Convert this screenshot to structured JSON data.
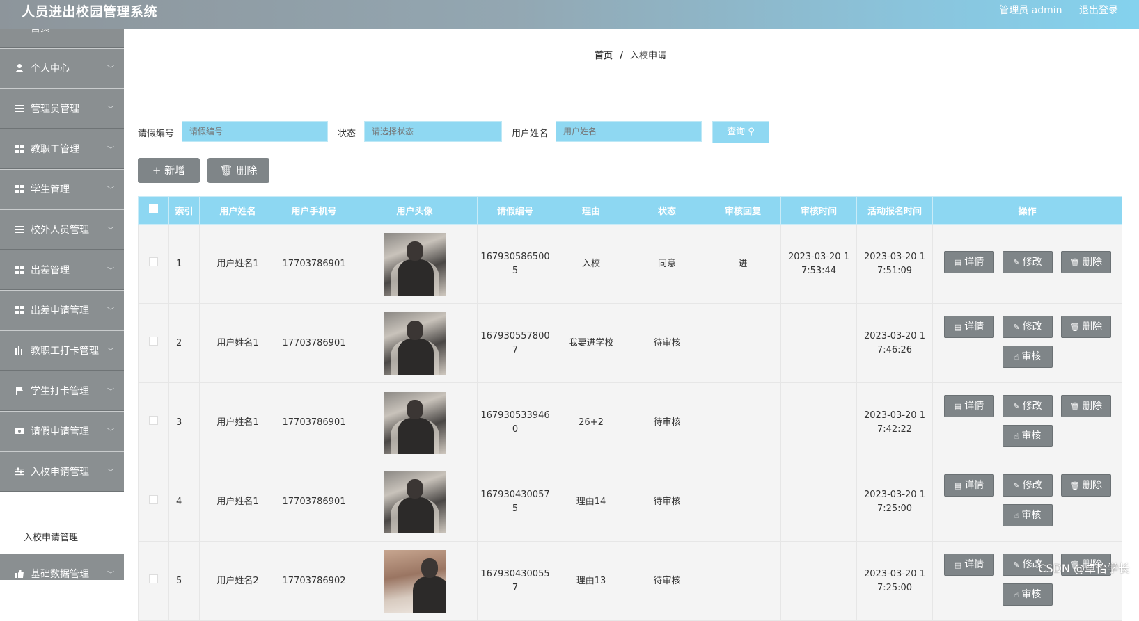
{
  "app": {
    "title": "人员进出校园管理系统",
    "user_label": "管理员 admin",
    "logout_label": "退出登录"
  },
  "sidebar": {
    "items": [
      {
        "label": "首页",
        "icon": "home-icon"
      },
      {
        "label": "个人中心",
        "icon": "user-icon"
      },
      {
        "label": "管理员管理",
        "icon": "list-icon"
      },
      {
        "label": "教职工管理",
        "icon": "grid-icon"
      },
      {
        "label": "学生管理",
        "icon": "grid-icon"
      },
      {
        "label": "校外人员管理",
        "icon": "list-icon"
      },
      {
        "label": "出差管理",
        "icon": "grid-icon"
      },
      {
        "label": "出差申请管理",
        "icon": "grid-icon"
      },
      {
        "label": "教职工打卡管理",
        "icon": "chart-icon"
      },
      {
        "label": "学生打卡管理",
        "icon": "flag-icon"
      },
      {
        "label": "请假申请管理",
        "icon": "ticket-icon"
      },
      {
        "label": "入校申请管理",
        "icon": "sliders-icon"
      },
      {
        "label": "基础数据管理",
        "icon": "thumb-icon"
      }
    ],
    "submenu_active": "入校申请管理"
  },
  "breadcrumb": {
    "home": "首页",
    "sep": "/",
    "current": "入校申请"
  },
  "search": {
    "leave_no_label": "请假编号",
    "leave_no_placeholder": "请假编号",
    "status_label": "状态",
    "status_placeholder": "请选择状态",
    "username_label": "用户姓名",
    "username_placeholder": "用户姓名",
    "query_label": "查询"
  },
  "actions": {
    "add_label": "新增",
    "delete_label": "删除"
  },
  "table": {
    "headers": [
      "索引",
      "用户姓名",
      "用户手机号",
      "用户头像",
      "请假编号",
      "理由",
      "状态",
      "审核回复",
      "审核时间",
      "活动报名时间",
      "操作"
    ],
    "op_labels": {
      "detail": "详情",
      "edit": "修改",
      "delete": "删除",
      "review": "审核"
    },
    "rows": [
      {
        "idx": "1",
        "name": "用户姓名1",
        "phone": "17703786901",
        "leave_no": "1679305865005",
        "reason": "入校",
        "status": "同意",
        "reply": "进",
        "review_time": "2023-03-20 17:53:44",
        "signup_time": "2023-03-20 17:51:09"
      },
      {
        "idx": "2",
        "name": "用户姓名1",
        "phone": "17703786901",
        "leave_no": "1679305578007",
        "reason": "我要进学校",
        "status": "待审核",
        "reply": "",
        "review_time": "",
        "signup_time": "2023-03-20 17:46:26"
      },
      {
        "idx": "3",
        "name": "用户姓名1",
        "phone": "17703786901",
        "leave_no": "1679305339460",
        "reason": "26+2",
        "status": "待审核",
        "reply": "",
        "review_time": "",
        "signup_time": "2023-03-20 17:42:22"
      },
      {
        "idx": "4",
        "name": "用户姓名1",
        "phone": "17703786901",
        "leave_no": "1679304300575",
        "reason": "理由14",
        "status": "待审核",
        "reply": "",
        "review_time": "",
        "signup_time": "2023-03-20 17:25:00"
      },
      {
        "idx": "5",
        "name": "用户姓名2",
        "phone": "17703786902",
        "leave_no": "1679304300557",
        "reason": "理由13",
        "status": "待审核",
        "reply": "",
        "review_time": "",
        "signup_time": "2023-03-20 17:25:00"
      }
    ]
  },
  "watermark": "CSDN @卓怡学长",
  "colors": {
    "sidebar_item": "#8a8f91",
    "table_header": "#8dd7f2",
    "button_gray": "#7f8588"
  }
}
